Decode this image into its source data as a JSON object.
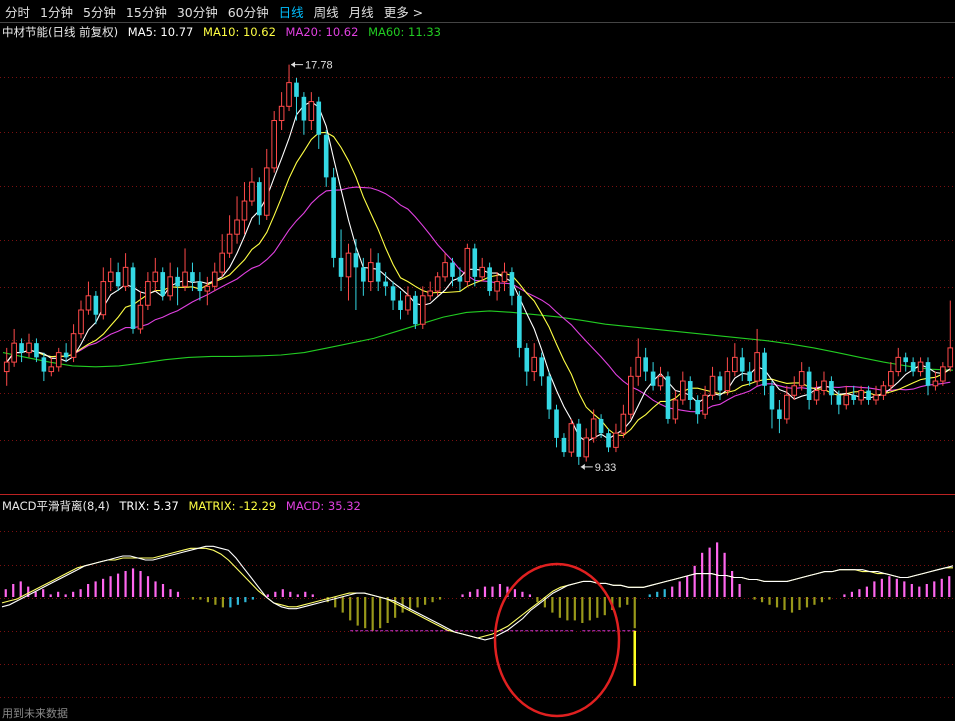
{
  "tabs": [
    {
      "label": "分时",
      "active": false
    },
    {
      "label": "1分钟",
      "active": false
    },
    {
      "label": "5分钟",
      "active": false
    },
    {
      "label": "15分钟",
      "active": false
    },
    {
      "label": "30分钟",
      "active": false
    },
    {
      "label": "60分钟",
      "active": false
    },
    {
      "label": "日线",
      "active": true
    },
    {
      "label": "周线",
      "active": false
    },
    {
      "label": "月线",
      "active": false
    },
    {
      "label": "更多 >",
      "active": false
    }
  ],
  "main_legend": {
    "title": "中材节能(日线 前复权)",
    "ma5": "MA5: 10.77",
    "ma10": "MA10: 10.62",
    "ma20": "MA20: 10.62",
    "ma60": "MA60: 11.33"
  },
  "macd_legend": {
    "title": "MACD平滑背离(8,4)",
    "trix": "TRIX: 5.37",
    "matrix": "MATRIX: -12.29",
    "macd": "MACD: 35.32"
  },
  "footer_note": "用到未来数据",
  "colors": {
    "up": "#ff4a4a",
    "down": "#34d8e4",
    "ma5": "#ffffff",
    "ma10": "#ffff44",
    "ma20": "#e040e0",
    "ma60": "#22cc22",
    "hist_pos": "#ff66ee",
    "hist_neg": "#99991a",
    "hist_cyan": "#2fb8d8",
    "highlight_circle": "#e02020"
  },
  "chart_data": {
    "type": "candlestick",
    "price_range": [
      8.8,
      18.3
    ],
    "annotations": [
      {
        "label": "17.78",
        "value": 17.78,
        "kind": "high"
      },
      {
        "label": "9.33",
        "value": 9.33,
        "kind": "low"
      }
    ],
    "candles": [
      {
        "o": 11.3,
        "c": 11.5,
        "h": 11.8,
        "l": 11.0
      },
      {
        "o": 11.5,
        "c": 11.9,
        "h": 12.2,
        "l": 11.4
      },
      {
        "o": 11.9,
        "c": 11.7,
        "h": 12.0,
        "l": 11.5
      },
      {
        "o": 11.7,
        "c": 11.9,
        "h": 12.1,
        "l": 11.6
      },
      {
        "o": 11.9,
        "c": 11.6,
        "h": 12.0,
        "l": 11.5
      },
      {
        "o": 11.6,
        "c": 11.3,
        "h": 11.7,
        "l": 11.1
      },
      {
        "o": 11.3,
        "c": 11.4,
        "h": 11.6,
        "l": 11.2
      },
      {
        "o": 11.4,
        "c": 11.7,
        "h": 11.8,
        "l": 11.3
      },
      {
        "o": 11.7,
        "c": 11.6,
        "h": 11.9,
        "l": 11.5
      },
      {
        "o": 11.6,
        "c": 12.1,
        "h": 12.3,
        "l": 11.5
      },
      {
        "o": 12.1,
        "c": 12.6,
        "h": 12.8,
        "l": 12.0
      },
      {
        "o": 12.6,
        "c": 12.9,
        "h": 13.2,
        "l": 12.5
      },
      {
        "o": 12.9,
        "c": 12.5,
        "h": 13.0,
        "l": 12.3
      },
      {
        "o": 12.5,
        "c": 13.2,
        "h": 13.5,
        "l": 12.4
      },
      {
        "o": 13.2,
        "c": 13.4,
        "h": 13.7,
        "l": 13.0
      },
      {
        "o": 13.4,
        "c": 13.1,
        "h": 13.6,
        "l": 13.0
      },
      {
        "o": 13.1,
        "c": 13.5,
        "h": 13.8,
        "l": 13.0
      },
      {
        "o": 13.5,
        "c": 12.2,
        "h": 13.6,
        "l": 12.1
      },
      {
        "o": 12.2,
        "c": 12.7,
        "h": 13.0,
        "l": 12.1
      },
      {
        "o": 12.7,
        "c": 13.2,
        "h": 13.4,
        "l": 12.6
      },
      {
        "o": 13.2,
        "c": 13.4,
        "h": 13.7,
        "l": 13.0
      },
      {
        "o": 13.4,
        "c": 12.9,
        "h": 13.5,
        "l": 12.8
      },
      {
        "o": 12.9,
        "c": 13.3,
        "h": 13.6,
        "l": 12.8
      },
      {
        "o": 13.3,
        "c": 13.1,
        "h": 13.5,
        "l": 12.7
      },
      {
        "o": 13.1,
        "c": 13.4,
        "h": 13.9,
        "l": 13.0
      },
      {
        "o": 13.4,
        "c": 13.2,
        "h": 13.6,
        "l": 13.0
      },
      {
        "o": 13.2,
        "c": 13.0,
        "h": 13.4,
        "l": 12.8
      },
      {
        "o": 13.0,
        "c": 13.1,
        "h": 13.3,
        "l": 12.7
      },
      {
        "o": 13.1,
        "c": 13.4,
        "h": 13.6,
        "l": 13.0
      },
      {
        "o": 13.4,
        "c": 13.8,
        "h": 14.2,
        "l": 13.3
      },
      {
        "o": 13.8,
        "c": 14.2,
        "h": 14.6,
        "l": 13.7
      },
      {
        "o": 14.2,
        "c": 14.5,
        "h": 15.0,
        "l": 14.0
      },
      {
        "o": 14.5,
        "c": 14.9,
        "h": 15.3,
        "l": 14.2
      },
      {
        "o": 14.9,
        "c": 15.3,
        "h": 15.6,
        "l": 14.8
      },
      {
        "o": 15.3,
        "c": 14.6,
        "h": 15.4,
        "l": 14.4
      },
      {
        "o": 14.6,
        "c": 15.6,
        "h": 16.0,
        "l": 14.5
      },
      {
        "o": 15.6,
        "c": 16.6,
        "h": 16.8,
        "l": 15.5
      },
      {
        "o": 16.6,
        "c": 16.9,
        "h": 17.2,
        "l": 16.4
      },
      {
        "o": 16.9,
        "c": 17.4,
        "h": 17.78,
        "l": 16.8
      },
      {
        "o": 17.4,
        "c": 17.1,
        "h": 17.5,
        "l": 16.6
      },
      {
        "o": 17.1,
        "c": 16.6,
        "h": 17.2,
        "l": 16.3
      },
      {
        "o": 16.6,
        "c": 17.0,
        "h": 17.2,
        "l": 16.4
      },
      {
        "o": 17.0,
        "c": 16.3,
        "h": 17.1,
        "l": 16.0
      },
      {
        "o": 16.3,
        "c": 15.4,
        "h": 16.4,
        "l": 15.2
      },
      {
        "o": 15.4,
        "c": 13.7,
        "h": 15.6,
        "l": 13.5
      },
      {
        "o": 13.7,
        "c": 13.3,
        "h": 14.3,
        "l": 13.0
      },
      {
        "o": 13.3,
        "c": 13.8,
        "h": 14.0,
        "l": 12.8
      },
      {
        "o": 13.8,
        "c": 13.5,
        "h": 14.1,
        "l": 12.6
      },
      {
        "o": 13.5,
        "c": 13.2,
        "h": 13.7,
        "l": 12.9
      },
      {
        "o": 13.2,
        "c": 13.6,
        "h": 13.9,
        "l": 13.0
      },
      {
        "o": 13.6,
        "c": 13.2,
        "h": 13.8,
        "l": 13.0
      },
      {
        "o": 13.2,
        "c": 13.1,
        "h": 13.4,
        "l": 12.9
      },
      {
        "o": 13.1,
        "c": 12.8,
        "h": 13.2,
        "l": 12.6
      },
      {
        "o": 12.8,
        "c": 12.6,
        "h": 13.0,
        "l": 12.4
      },
      {
        "o": 12.6,
        "c": 12.9,
        "h": 13.1,
        "l": 12.5
      },
      {
        "o": 12.9,
        "c": 12.3,
        "h": 13.0,
        "l": 12.2
      },
      {
        "o": 12.3,
        "c": 12.9,
        "h": 13.1,
        "l": 12.2
      },
      {
        "o": 12.9,
        "c": 13.0,
        "h": 13.2,
        "l": 12.8
      },
      {
        "o": 13.0,
        "c": 13.3,
        "h": 13.4,
        "l": 12.9
      },
      {
        "o": 13.3,
        "c": 13.6,
        "h": 13.8,
        "l": 13.2
      },
      {
        "o": 13.6,
        "c": 13.3,
        "h": 13.7,
        "l": 13.1
      },
      {
        "o": 13.3,
        "c": 13.2,
        "h": 13.5,
        "l": 13.0
      },
      {
        "o": 13.2,
        "c": 13.9,
        "h": 14.0,
        "l": 13.1
      },
      {
        "o": 13.9,
        "c": 13.3,
        "h": 14.0,
        "l": 13.1
      },
      {
        "o": 13.3,
        "c": 13.5,
        "h": 13.7,
        "l": 13.2
      },
      {
        "o": 13.5,
        "c": 13.0,
        "h": 13.6,
        "l": 12.9
      },
      {
        "o": 13.0,
        "c": 13.2,
        "h": 13.4,
        "l": 12.8
      },
      {
        "o": 13.2,
        "c": 13.4,
        "h": 13.6,
        "l": 13.0
      },
      {
        "o": 13.4,
        "c": 12.9,
        "h": 13.5,
        "l": 12.7
      },
      {
        "o": 12.9,
        "c": 11.8,
        "h": 13.0,
        "l": 11.6
      },
      {
        "o": 11.8,
        "c": 11.3,
        "h": 11.9,
        "l": 11.0
      },
      {
        "o": 11.3,
        "c": 11.6,
        "h": 11.9,
        "l": 11.1
      },
      {
        "o": 11.6,
        "c": 11.2,
        "h": 11.7,
        "l": 11.0
      },
      {
        "o": 11.2,
        "c": 10.5,
        "h": 11.3,
        "l": 10.3
      },
      {
        "o": 10.5,
        "c": 9.9,
        "h": 10.6,
        "l": 9.7
      },
      {
        "o": 9.9,
        "c": 9.6,
        "h": 10.0,
        "l": 9.5
      },
      {
        "o": 9.6,
        "c": 10.2,
        "h": 10.3,
        "l": 9.5
      },
      {
        "o": 10.2,
        "c": 9.5,
        "h": 10.3,
        "l": 9.33
      },
      {
        "o": 9.5,
        "c": 9.9,
        "h": 10.1,
        "l": 9.4
      },
      {
        "o": 9.9,
        "c": 10.3,
        "h": 10.5,
        "l": 9.8
      },
      {
        "o": 10.3,
        "c": 10.0,
        "h": 10.4,
        "l": 9.9
      },
      {
        "o": 10.0,
        "c": 9.7,
        "h": 10.1,
        "l": 9.6
      },
      {
        "o": 9.7,
        "c": 10.0,
        "h": 10.2,
        "l": 9.6
      },
      {
        "o": 10.0,
        "c": 10.4,
        "h": 10.6,
        "l": 9.9
      },
      {
        "o": 10.4,
        "c": 11.2,
        "h": 11.4,
        "l": 10.3
      },
      {
        "o": 11.2,
        "c": 11.6,
        "h": 12.0,
        "l": 11.0
      },
      {
        "o": 11.6,
        "c": 11.3,
        "h": 11.8,
        "l": 11.1
      },
      {
        "o": 11.3,
        "c": 11.0,
        "h": 11.5,
        "l": 10.9
      },
      {
        "o": 11.0,
        "c": 11.2,
        "h": 11.4,
        "l": 10.9
      },
      {
        "o": 11.2,
        "c": 10.3,
        "h": 11.3,
        "l": 10.2
      },
      {
        "o": 10.3,
        "c": 10.7,
        "h": 10.9,
        "l": 10.2
      },
      {
        "o": 10.7,
        "c": 11.1,
        "h": 11.3,
        "l": 10.6
      },
      {
        "o": 11.1,
        "c": 10.7,
        "h": 11.2,
        "l": 10.5
      },
      {
        "o": 10.7,
        "c": 10.4,
        "h": 10.8,
        "l": 10.2
      },
      {
        "o": 10.4,
        "c": 10.8,
        "h": 11.0,
        "l": 10.3
      },
      {
        "o": 10.8,
        "c": 11.2,
        "h": 11.4,
        "l": 10.7
      },
      {
        "o": 11.2,
        "c": 10.9,
        "h": 11.3,
        "l": 10.7
      },
      {
        "o": 10.9,
        "c": 11.3,
        "h": 11.6,
        "l": 10.8
      },
      {
        "o": 11.3,
        "c": 11.6,
        "h": 11.9,
        "l": 11.2
      },
      {
        "o": 11.6,
        "c": 11.3,
        "h": 11.8,
        "l": 11.1
      },
      {
        "o": 11.3,
        "c": 11.1,
        "h": 11.5,
        "l": 11.0
      },
      {
        "o": 11.1,
        "c": 11.7,
        "h": 12.2,
        "l": 11.0
      },
      {
        "o": 11.7,
        "c": 11.0,
        "h": 11.8,
        "l": 10.8
      },
      {
        "o": 11.0,
        "c": 10.5,
        "h": 11.1,
        "l": 10.1
      },
      {
        "o": 10.5,
        "c": 10.3,
        "h": 10.7,
        "l": 10.0
      },
      {
        "o": 10.3,
        "c": 10.8,
        "h": 11.0,
        "l": 10.2
      },
      {
        "o": 10.8,
        "c": 11.0,
        "h": 11.2,
        "l": 10.7
      },
      {
        "o": 11.0,
        "c": 11.3,
        "h": 11.5,
        "l": 10.9
      },
      {
        "o": 11.3,
        "c": 10.7,
        "h": 11.4,
        "l": 10.5
      },
      {
        "o": 10.7,
        "c": 10.9,
        "h": 11.1,
        "l": 10.6
      },
      {
        "o": 10.9,
        "c": 11.1,
        "h": 11.3,
        "l": 10.8
      },
      {
        "o": 11.1,
        "c": 10.8,
        "h": 11.2,
        "l": 10.6
      },
      {
        "o": 10.8,
        "c": 10.6,
        "h": 10.9,
        "l": 10.4
      },
      {
        "o": 10.6,
        "c": 10.8,
        "h": 11.0,
        "l": 10.5
      },
      {
        "o": 10.8,
        "c": 10.7,
        "h": 11.0,
        "l": 10.6
      },
      {
        "o": 10.7,
        "c": 10.9,
        "h": 11.0,
        "l": 10.6
      },
      {
        "o": 10.9,
        "c": 10.7,
        "h": 11.0,
        "l": 10.6
      },
      {
        "o": 10.7,
        "c": 10.8,
        "h": 11.0,
        "l": 10.6
      },
      {
        "o": 10.8,
        "c": 11.0,
        "h": 11.1,
        "l": 10.7
      },
      {
        "o": 11.0,
        "c": 11.3,
        "h": 11.5,
        "l": 10.9
      },
      {
        "o": 11.3,
        "c": 11.6,
        "h": 11.8,
        "l": 11.2
      },
      {
        "o": 11.6,
        "c": 11.5,
        "h": 11.7,
        "l": 11.3
      },
      {
        "o": 11.5,
        "c": 11.3,
        "h": 11.6,
        "l": 11.2
      },
      {
        "o": 11.3,
        "c": 11.5,
        "h": 11.6,
        "l": 11.2
      },
      {
        "o": 11.5,
        "c": 11.0,
        "h": 11.6,
        "l": 10.8
      },
      {
        "o": 11.0,
        "c": 11.1,
        "h": 11.3,
        "l": 10.9
      },
      {
        "o": 11.1,
        "c": 11.4,
        "h": 11.5,
        "l": 11.0
      },
      {
        "o": 11.4,
        "c": 11.8,
        "h": 12.8,
        "l": 11.3
      }
    ],
    "ma60": [
      11.7,
      11.6,
      11.5,
      11.42,
      11.4,
      11.42,
      11.48,
      11.55,
      11.6,
      11.62,
      11.62,
      11.63,
      11.65,
      11.7,
      11.8,
      11.9,
      12.0,
      12.15,
      12.3,
      12.45,
      12.55,
      12.58,
      12.55,
      12.5,
      12.45,
      12.38,
      12.3,
      12.25,
      12.2,
      12.15,
      12.1,
      12.05,
      12.0,
      11.95,
      11.88,
      11.8,
      11.7,
      11.6,
      11.5,
      11.42,
      11.35,
      11.33
    ],
    "macd_panel": {
      "histogram": [
        3,
        5,
        6,
        4,
        2,
        3,
        1,
        2,
        1,
        2,
        3,
        5,
        6,
        7,
        8,
        9,
        10,
        11,
        10,
        8,
        6,
        5,
        3,
        2,
        0,
        -1,
        -1,
        -2,
        -3,
        -4,
        -4,
        -3,
        -2,
        -1,
        0,
        1,
        2,
        3,
        2,
        1,
        2,
        1,
        0,
        -2,
        -4,
        -6,
        -9,
        -11,
        -12,
        -13,
        -12,
        -10,
        -8,
        -6,
        -5,
        -4,
        -3,
        -2,
        -1,
        0,
        0,
        1,
        2,
        3,
        4,
        4,
        5,
        4,
        3,
        2,
        1,
        -2,
        -4,
        -6,
        -8,
        -9,
        -9,
        -10,
        -9,
        -8,
        -7,
        -5,
        -4,
        -3,
        -12,
        0,
        1,
        2,
        3,
        4,
        6,
        8,
        12,
        17,
        19,
        21,
        17,
        10,
        5,
        0,
        -1,
        -2,
        -3,
        -4,
        -5,
        -6,
        -5,
        -4,
        -3,
        -2,
        -1,
        0,
        1,
        2,
        3,
        4,
        6,
        7,
        8,
        7,
        6,
        5,
        4,
        5,
        6,
        7,
        8
      ],
      "line1": [
        -5,
        -4,
        -2,
        0,
        2,
        4,
        6,
        8,
        10,
        12,
        14,
        16,
        17,
        18,
        19,
        20,
        21,
        21,
        20,
        19,
        19,
        20,
        21,
        22,
        23,
        24,
        25,
        26,
        26,
        25,
        24,
        20,
        15,
        10,
        5,
        0,
        -3,
        -5,
        -6,
        -6,
        -5,
        -4,
        -3,
        -2,
        -1,
        0,
        1,
        2,
        2,
        1,
        0,
        -1,
        -2,
        -4,
        -6,
        -8,
        -10,
        -12,
        -14,
        -16,
        -18,
        -19,
        -20,
        -21,
        -22,
        -21,
        -19,
        -17,
        -14,
        -11,
        -7,
        -4,
        -1,
        2,
        4,
        6,
        7,
        8,
        8,
        7,
        7,
        6,
        6,
        5,
        5,
        5,
        6,
        7,
        8,
        9,
        10,
        11,
        12,
        12,
        12,
        11,
        11,
        10,
        10,
        9,
        9,
        8,
        8,
        8,
        8,
        9,
        10,
        11,
        12,
        13,
        13,
        14,
        14,
        14,
        14,
        13,
        13,
        12,
        11,
        10,
        10,
        11,
        12,
        13,
        14,
        15,
        16
      ],
      "line2": [
        -3,
        -2,
        -1,
        1,
        3,
        5,
        7,
        9,
        11,
        13,
        15,
        16,
        17,
        18,
        19,
        19,
        20,
        20,
        20,
        20,
        20,
        21,
        22,
        23,
        24,
        25,
        25,
        25,
        24,
        22,
        19,
        15,
        11,
        7,
        3,
        0,
        -3,
        -4,
        -5,
        -5,
        -4,
        -3,
        -2,
        -1,
        0,
        1,
        2,
        2,
        2,
        1,
        0,
        -1,
        -3,
        -5,
        -7,
        -9,
        -11,
        -13,
        -15,
        -17,
        -18,
        -19,
        -20,
        -21,
        -20,
        -19,
        -17,
        -15,
        -12,
        -9,
        -6,
        -3,
        0,
        3,
        5,
        6,
        7,
        8,
        8,
        7,
        7,
        6,
        6,
        5,
        5,
        5,
        6,
        7,
        8,
        9,
        10,
        11,
        12,
        12,
        12,
        11,
        11,
        10,
        10,
        9,
        9,
        8,
        8,
        8,
        8,
        9,
        10,
        11,
        12,
        13,
        13,
        14,
        14,
        14,
        13,
        13,
        12,
        12,
        11,
        10,
        10,
        11,
        12,
        13,
        14,
        15,
        15
      ],
      "yellow_spike_value": -18
    }
  }
}
